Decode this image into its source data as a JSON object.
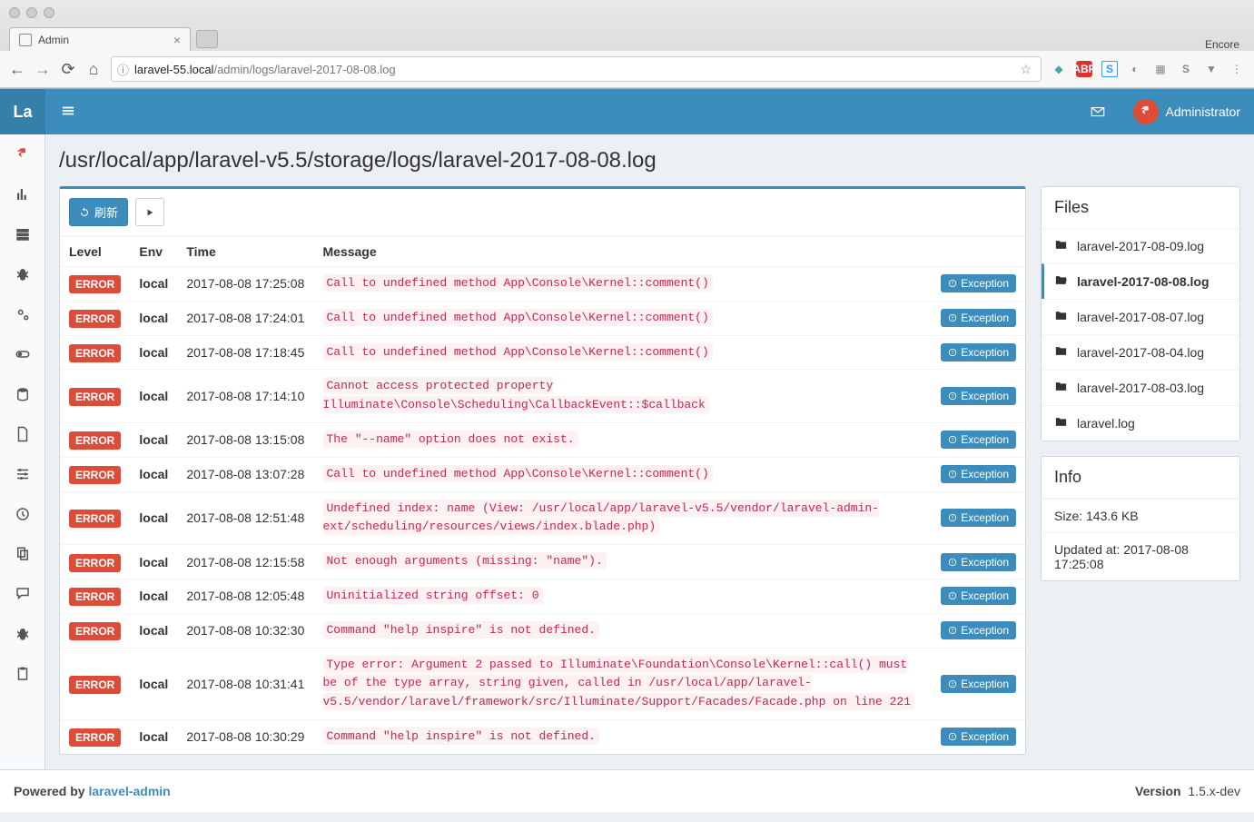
{
  "browser": {
    "tab_title": "Admin",
    "encore": "Encore",
    "url_prefix": "laravel-55.local",
    "url_path": "/admin/logs/laravel-2017-08-08.log"
  },
  "header": {
    "logo": "La",
    "user_name": "Administrator"
  },
  "page": {
    "title": "/usr/local/app/laravel-v5.5/storage/logs/laravel-2017-08-08.log"
  },
  "buttons": {
    "refresh": "刷新",
    "exception": "Exception"
  },
  "columns": {
    "level": "Level",
    "env": "Env",
    "time": "Time",
    "message": "Message"
  },
  "logs": [
    {
      "level": "ERROR",
      "env": "local",
      "time": "2017-08-08 17:25:08",
      "message": "Call to undefined method App\\Console\\Kernel::comment()"
    },
    {
      "level": "ERROR",
      "env": "local",
      "time": "2017-08-08 17:24:01",
      "message": "Call to undefined method App\\Console\\Kernel::comment()"
    },
    {
      "level": "ERROR",
      "env": "local",
      "time": "2017-08-08 17:18:45",
      "message": "Call to undefined method App\\Console\\Kernel::comment()"
    },
    {
      "level": "ERROR",
      "env": "local",
      "time": "2017-08-08 17:14:10",
      "message": "Cannot access protected property Illuminate\\Console\\Scheduling\\CallbackEvent::$callback"
    },
    {
      "level": "ERROR",
      "env": "local",
      "time": "2017-08-08 13:15:08",
      "message": "The \"--name\" option does not exist."
    },
    {
      "level": "ERROR",
      "env": "local",
      "time": "2017-08-08 13:07:28",
      "message": "Call to undefined method App\\Console\\Kernel::comment()"
    },
    {
      "level": "ERROR",
      "env": "local",
      "time": "2017-08-08 12:51:48",
      "message": "Undefined index: name (View: /usr/local/app/laravel-v5.5/vendor/laravel-admin-ext/scheduling/resources/views/index.blade.php)"
    },
    {
      "level": "ERROR",
      "env": "local",
      "time": "2017-08-08 12:15:58",
      "message": "Not enough arguments (missing: \"name\")."
    },
    {
      "level": "ERROR",
      "env": "local",
      "time": "2017-08-08 12:05:48",
      "message": "Uninitialized string offset: 0"
    },
    {
      "level": "ERROR",
      "env": "local",
      "time": "2017-08-08 10:32:30",
      "message": "Command \"help inspire\" is not defined."
    },
    {
      "level": "ERROR",
      "env": "local",
      "time": "2017-08-08 10:31:41",
      "message": "Type error: Argument 2 passed to Illuminate\\Foundation\\Console\\Kernel::call() must be of the type array, string given, called in /usr/local/app/laravel-v5.5/vendor/laravel/framework/src/Illuminate/Support/Facades/Facade.php on line 221"
    },
    {
      "level": "ERROR",
      "env": "local",
      "time": "2017-08-08 10:30:29",
      "message": "Command \"help inspire\" is not defined."
    }
  ],
  "files_panel": {
    "title": "Files",
    "items": [
      {
        "name": "laravel-2017-08-09.log",
        "active": false
      },
      {
        "name": "laravel-2017-08-08.log",
        "active": true
      },
      {
        "name": "laravel-2017-08-07.log",
        "active": false
      },
      {
        "name": "laravel-2017-08-04.log",
        "active": false
      },
      {
        "name": "laravel-2017-08-03.log",
        "active": false
      },
      {
        "name": "laravel.log",
        "active": false
      }
    ]
  },
  "info_panel": {
    "title": "Info",
    "size_label": "Size: 143.6 KB",
    "updated_label": "Updated at: 2017-08-08 17:25:08"
  },
  "footer": {
    "powered_by": "Powered by ",
    "link": "laravel-admin",
    "version_label": "Version",
    "version": "1.5.x-dev"
  }
}
